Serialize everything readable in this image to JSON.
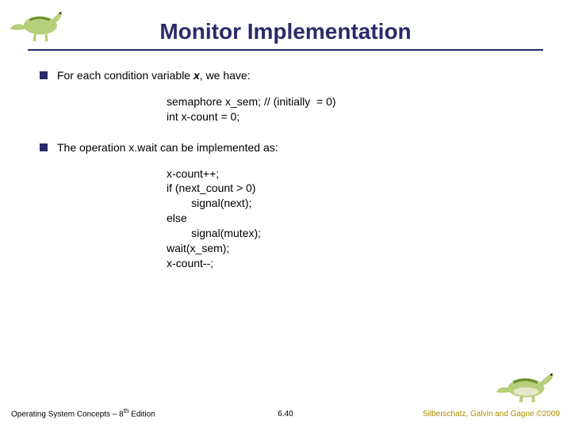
{
  "title": "Monitor Implementation",
  "bullets": [
    {
      "pre": "For each condition variable ",
      "var": "x",
      "post": ", we  have:"
    },
    {
      "pre": "The operation ",
      "code": "x.wait",
      "post": " can be implemented as:"
    }
  ],
  "code_blocks": [
    "semaphore x_sem; // (initially  = 0)\nint x-count = 0;",
    "x-count++;\nif (next_count > 0)\n        signal(next);\nelse\n        signal(mutex);\nwait(x_sem);\nx-count--;"
  ],
  "footer": {
    "left_pre": "Operating System Concepts – 8",
    "left_sup": "th",
    "left_post": " Edition",
    "center": "6.40",
    "right": "Silberschatz, Galvin and Gagne ©2009"
  },
  "icons": {
    "top_left": "dinosaur-small-icon",
    "bottom_right": "dinosaur-large-icon"
  }
}
